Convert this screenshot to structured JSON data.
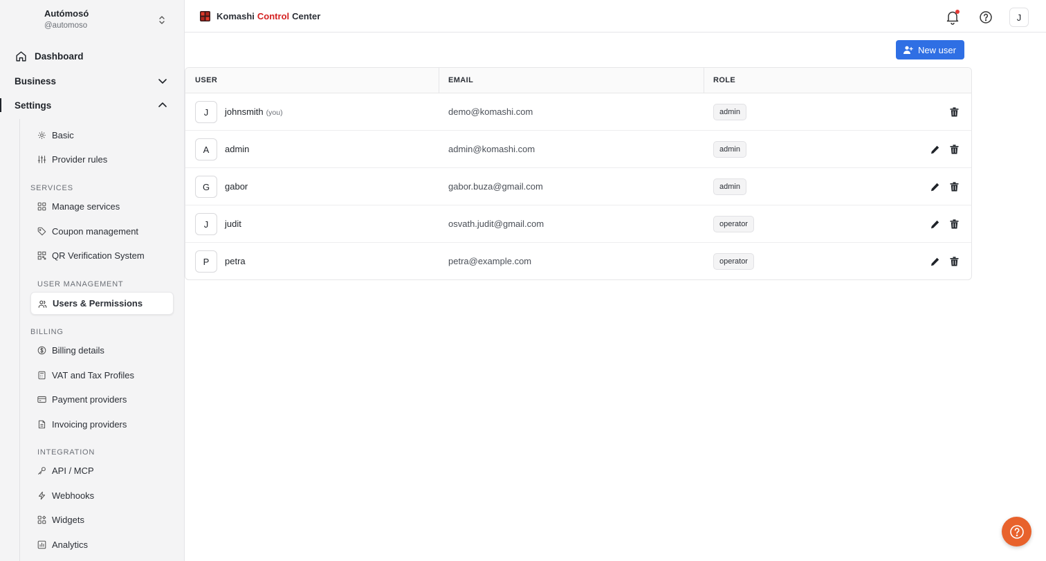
{
  "account": {
    "name": "Autómosó",
    "handle": "@automoso"
  },
  "nav": {
    "dashboard": "Dashboard",
    "business": "Business",
    "settings": "Settings"
  },
  "settings_menu": {
    "basic": "Basic",
    "provider_rules": "Provider rules",
    "services_label": "SERVICES",
    "manage_services": "Manage services",
    "coupon_management": "Coupon management",
    "qr_verification": "QR Verification System",
    "user_management_label": "USER MANAGEMENT",
    "users_permissions": "Users & Permissions",
    "billing_label": "BILLING",
    "billing_details": "Billing details",
    "vat_tax": "VAT and Tax Profiles",
    "payment_providers": "Payment providers",
    "invoicing_providers": "Invoicing providers",
    "integration_label": "INTEGRATION",
    "api_mcp": "API / MCP",
    "webhooks": "Webhooks",
    "widgets": "Widgets",
    "analytics": "Analytics"
  },
  "header": {
    "brand_part1": "Komashi",
    "brand_part2": "Control",
    "brand_part3": "Center",
    "avatar_initial": "J"
  },
  "toolbar": {
    "new_user_label": "New user"
  },
  "table": {
    "columns": [
      "USER",
      "EMAIL",
      "ROLE"
    ],
    "rows": [
      {
        "initial": "J",
        "username": "johnsmith",
        "you_tag": "(you)",
        "email": "demo@komashi.com",
        "role": "admin"
      },
      {
        "initial": "A",
        "username": "admin",
        "email": "admin@komashi.com",
        "role": "admin"
      },
      {
        "initial": "G",
        "username": "gabor",
        "email": "gabor.buza@gmail.com",
        "role": "admin"
      },
      {
        "initial": "J",
        "username": "judit",
        "email": "osvath.judit@gmail.com",
        "role": "operator"
      },
      {
        "initial": "P",
        "username": "petra",
        "email": "petra@example.com",
        "role": "operator"
      }
    ]
  },
  "colors": {
    "primary": "#2f6fe4",
    "brand_red": "#d42020",
    "help_fab": "#e8622c",
    "notification_dot": "#e53935"
  }
}
